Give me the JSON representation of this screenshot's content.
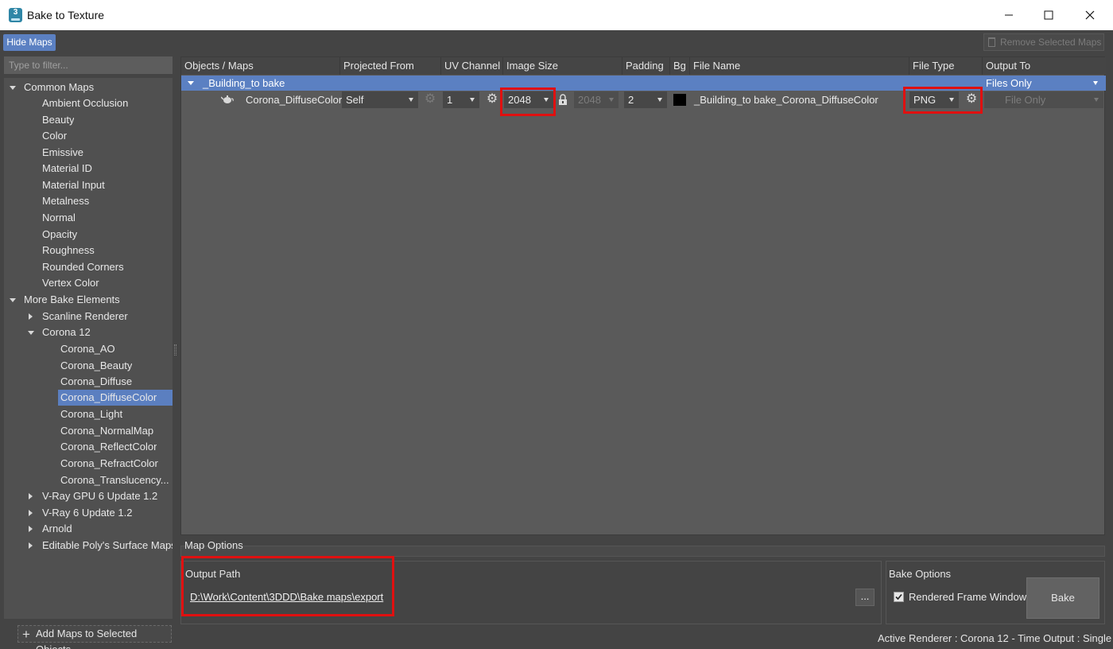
{
  "window": {
    "app_icon_label": "3",
    "title": "Bake to Texture",
    "minimize_glyph": "─",
    "maximize_glyph": "☐",
    "close_glyph": "✕"
  },
  "toolbar": {
    "hide_maps_label": "Hide Maps",
    "remove_maps_label": "Remove Selected Maps"
  },
  "filter": {
    "placeholder": "Type to filter..."
  },
  "tree": {
    "common_maps": {
      "label": "Common Maps",
      "items": [
        "Ambient Occlusion",
        "Beauty",
        "Color",
        "Emissive",
        "Material ID",
        "Material Input",
        "Metalness",
        "Normal",
        "Opacity",
        "Roughness",
        "Rounded Corners",
        "Vertex Color"
      ]
    },
    "more_bake": {
      "label": "More Bake Elements",
      "scanline": "Scanline Renderer",
      "corona": {
        "label": "Corona 12",
        "items": [
          "Corona_AO",
          "Corona_Beauty",
          "Corona_Diffuse",
          "Corona_DiffuseColor",
          "Corona_Light",
          "Corona_NormalMap",
          "Corona_ReflectColor",
          "Corona_RefractColor",
          "Corona_Translucency..."
        ],
        "selected": "Corona_DiffuseColor"
      },
      "vray_gpu": "V-Ray GPU 6 Update 1.2",
      "vray": "V-Ray 6 Update 1.2",
      "arnold": "Arnold",
      "editable_poly": "Editable Poly's Surface Maps"
    }
  },
  "add_maps_label": "Add Maps to Selected Objects",
  "table": {
    "headers": {
      "objects": "Objects / Maps",
      "projected": "Projected From",
      "uv": "UV Channel",
      "image_size": "Image Size",
      "padding": "Padding",
      "bg": "Bg",
      "file_name": "File Name",
      "file_type": "File Type",
      "output_to": "Output To"
    },
    "group": {
      "name": "_Building_to bake",
      "output_to": "Files Only"
    },
    "map": {
      "name": "Corona_DiffuseColor",
      "projected_from": "Self",
      "uv_channel": "1",
      "image_width": "2048",
      "image_height": "2048",
      "padding": "2",
      "bg_color": "#000000",
      "file_name": "_Building_to bake_Corona_DiffuseColor",
      "file_type": "PNG",
      "output_to": "File Only"
    }
  },
  "map_options_label": "Map Options",
  "output": {
    "label": "Output Path",
    "path": "D:\\Work\\Content\\3DDD\\Bake maps\\export",
    "browse_label": "..."
  },
  "bake_options": {
    "label": "Bake Options",
    "checkbox_label": "Rendered Frame Window",
    "checked": true,
    "bake_label": "Bake"
  },
  "status": "Active Renderer : Corona 12  -  Time Output : Single",
  "colors": {
    "accent": "#5b80c2",
    "highlight_box": "#e01010",
    "background": "#444444"
  }
}
